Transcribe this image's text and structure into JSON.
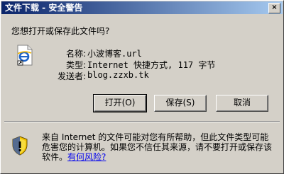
{
  "window": {
    "title": "文件下载 - 安全警告",
    "close_glyph": "×"
  },
  "question": "您想打开或保存此文件吗?",
  "file": {
    "name_label": "名称:",
    "name_value": "小波博客.url",
    "type_label": "类型:",
    "type_value": "Internet 快捷方式, 117 字节",
    "from_label": "发送者:",
    "from_value": "blog.zzxb.tk",
    "icon": "ie-shortcut-icon"
  },
  "buttons": {
    "open": "打开(O)",
    "save": "保存(S)",
    "cancel": "取消"
  },
  "warning": {
    "text": "来自 Internet 的文件可能对您有所帮助，但此文件类型可能危害您的计算机。如果您不信任其来源，请不要打开或保存该软件。",
    "link": "有何风险?",
    "icon": "shield-warning-icon"
  }
}
